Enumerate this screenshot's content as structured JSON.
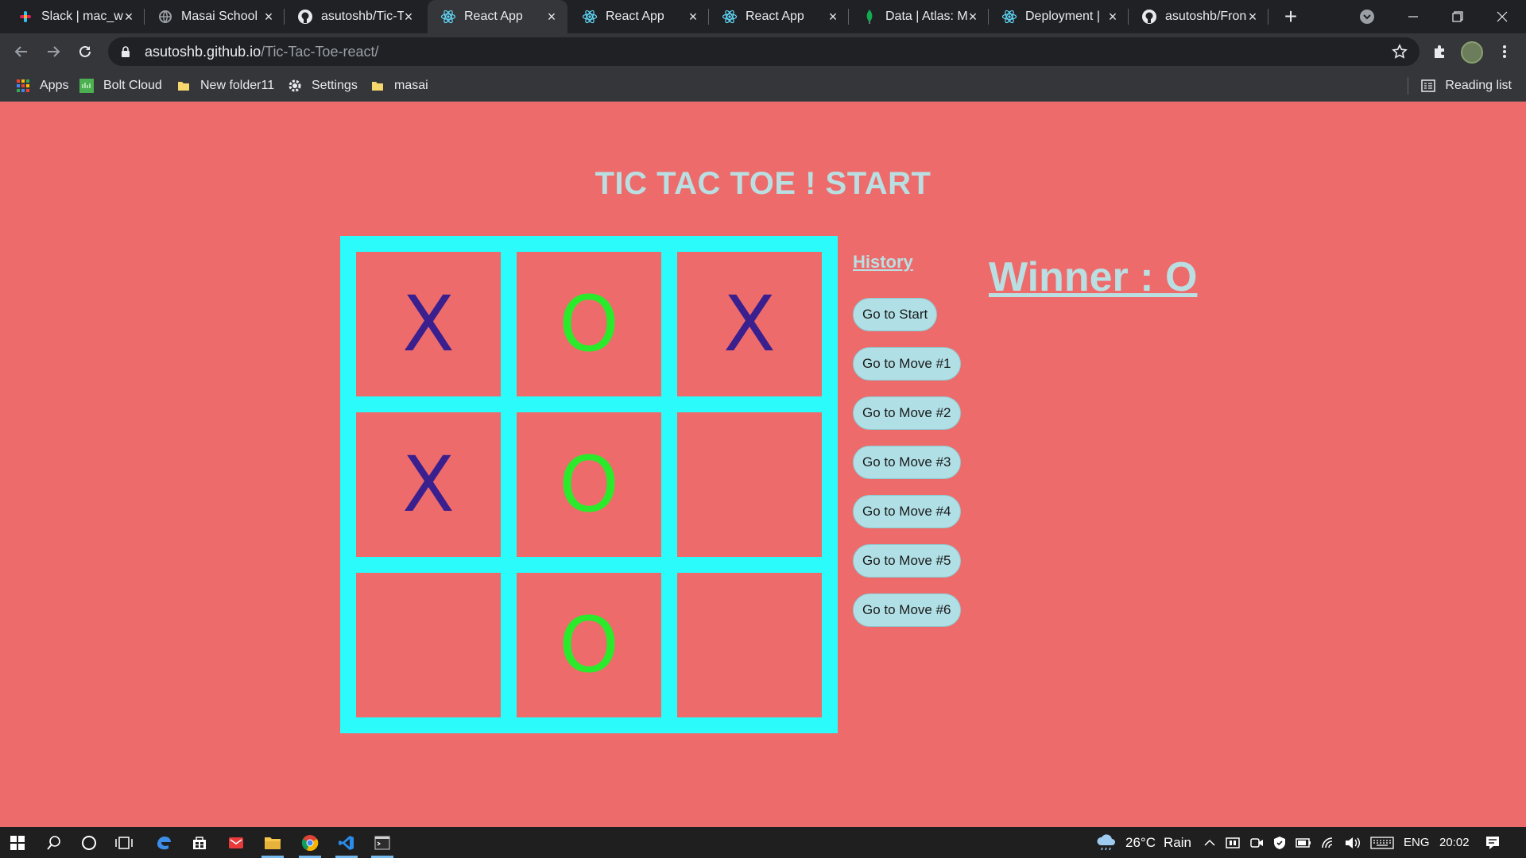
{
  "browser": {
    "tabs": [
      {
        "label": "Slack | mac_w",
        "icon": "slack-icon"
      },
      {
        "label": "Masai School",
        "icon": "globe-icon"
      },
      {
        "label": "asutoshb/Tic-T",
        "icon": "github-icon"
      },
      {
        "label": "React App",
        "icon": "react-icon"
      },
      {
        "label": "React App",
        "icon": "react-icon"
      },
      {
        "label": "React App",
        "icon": "react-icon"
      },
      {
        "label": "Data | Atlas: M",
        "icon": "mongodb-leaf-icon"
      },
      {
        "label": "Deployment | ",
        "icon": "react-icon"
      },
      {
        "label": "asutoshb/Fron",
        "icon": "github-icon"
      }
    ],
    "active_tab_index": 3,
    "url_host": "asutoshb.github.io",
    "url_path": "/Tic-Tac-Toe-react/",
    "bookmarks": [
      {
        "label": "Apps",
        "icon": "apps-grid-icon"
      },
      {
        "label": "Bolt Cloud",
        "icon": "bolt-cloud-icon"
      },
      {
        "label": "New folder11",
        "icon": "folder-icon"
      },
      {
        "label": "Settings",
        "icon": "gear-icon"
      },
      {
        "label": "masai",
        "icon": "folder-icon"
      }
    ],
    "reading_list": "Reading list"
  },
  "game": {
    "title": "TIC TAC TOE ! START",
    "board": [
      "X",
      "O",
      "X",
      "X",
      "O",
      "",
      "",
      "O",
      ""
    ],
    "history_label": "History",
    "moves": [
      "Go to Start",
      "Go to Move #1",
      "Go to Move #2",
      "Go to Move #3",
      "Go to Move #4",
      "Go to Move #5",
      "Go to Move #6"
    ],
    "winner": "Winner : O",
    "colors": {
      "background": "#ee6b6b",
      "board": "#2bfbfb",
      "x": "#3a1f8e",
      "o": "#2bea2b",
      "text": "#b9dfe2",
      "button": "#b0e0e6"
    }
  },
  "taskbar": {
    "weather_temp": "26°C",
    "weather_desc": "Rain",
    "language": "ENG",
    "time": "20:02"
  }
}
